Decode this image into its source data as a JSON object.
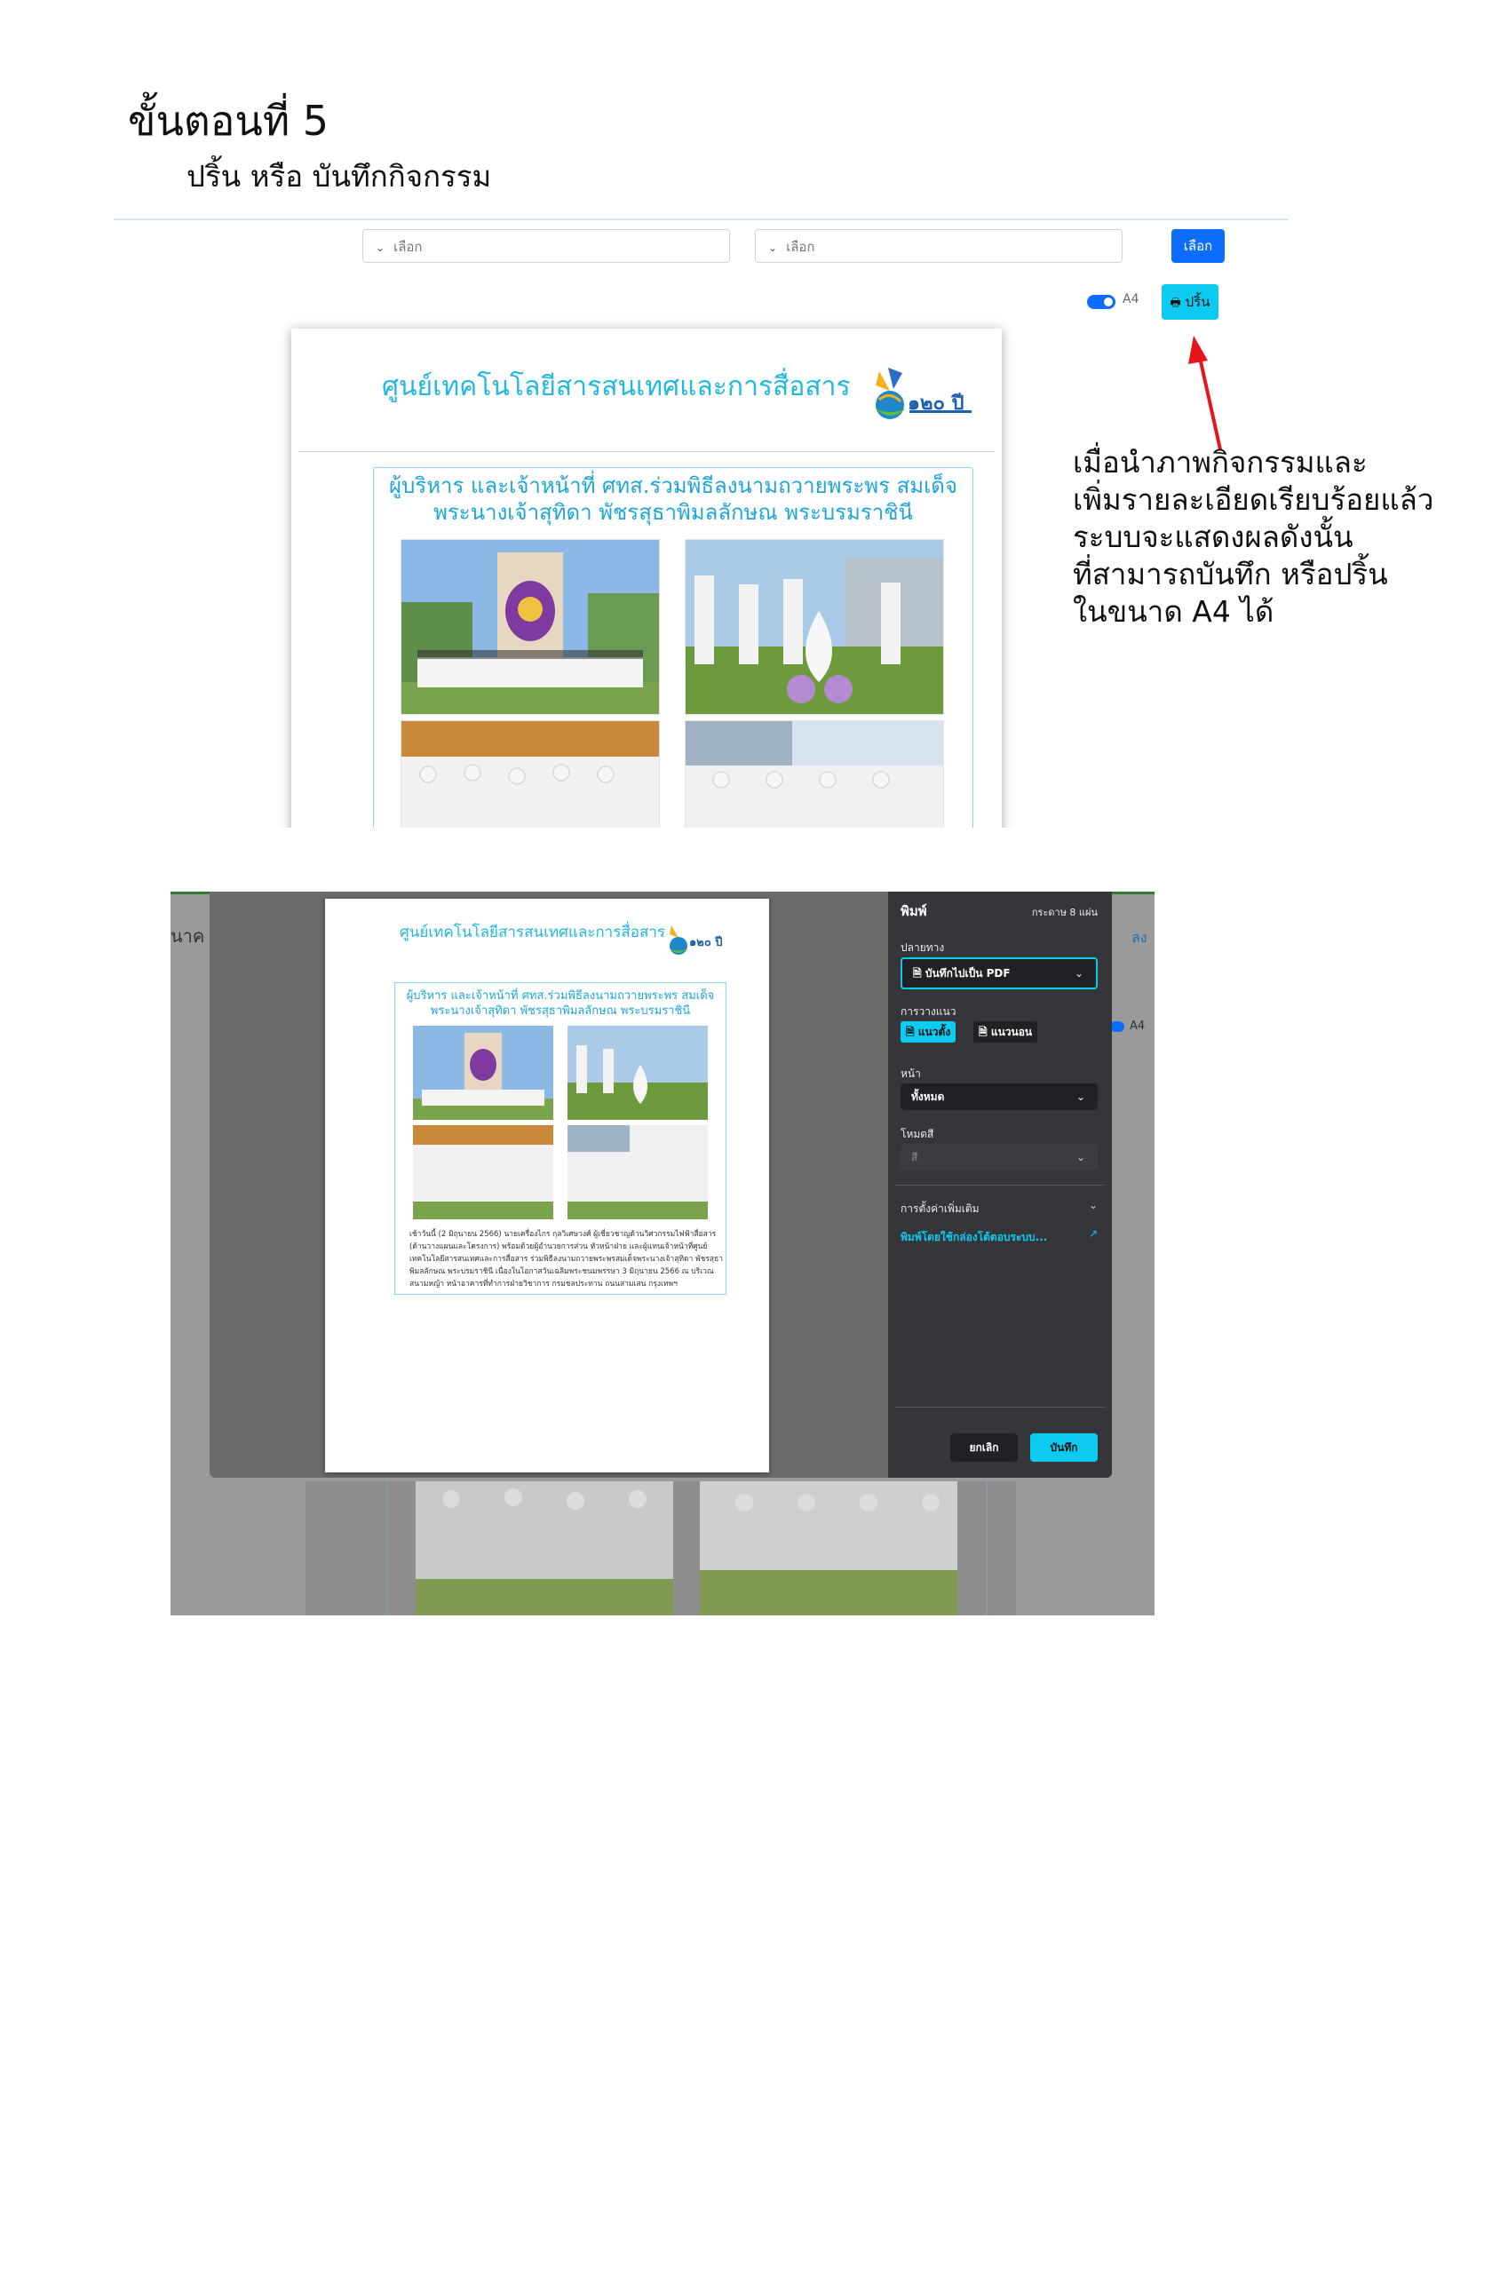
{
  "step": {
    "title": "ขั้นตอนที่ 5",
    "subtitle": "ปริ้น หรือ บันทึกกิจกรรม"
  },
  "toolbar": {
    "select1_placeholder": "เลือก",
    "select2_placeholder": "เลือก",
    "choose_button": "เลือก",
    "a4_toggle_label": "A4",
    "a4_toggle_on": true,
    "print_button": "ปริ้น"
  },
  "report": {
    "header": "ศูนย์เทคโนโลยีสารสนเทศและการสื่อสาร",
    "logo_text": "๑๒๐ ปี",
    "card_title_line1": "ผู้บริหาร และเจ้าหน้าที่ ศทส.ร่วมพิธีลงนามถวายพระพร สมเด็จ",
    "card_title_line2": "พระนางเจ้าสุทิดา พัชรสุธาพิมลลักษณ พระบรมราชินี",
    "body_text": [
      "เช้าวันนี้ (2 มิถุนายน 2566) นายเครื่องไกร กุลวิเศษวงศ์ ผู้เชี่ยวชาญด้านวิศวกรรมไฟฟ้าสื่อสาร",
      "(ด้านวางแผนและโครงการ) พร้อมด้วยผู้อำนวยการส่วน หัวหน้าฝ่าย และผู้แทนเจ้าหน้าที่ศูนย์",
      "เทคโนโลยีสารสนเทศและการสื่อสาร ร่วมพิธีลงนามถวายพระพรสมเด็จพระนางเจ้าสุทิดา พัชรสุธา",
      "พิมลลักษณ พระบรมราชินี เนื่องในโอกาสวันเฉลิมพระชนมพรรษา 3 มิถุนายน 2566 ณ บริเวณ",
      "สนามหญ้า หน้าอาคารที่ทำการฝ่ายวิชาการ กรมชลประทาน ถนนสามเสน กรุงเทพฯ"
    ]
  },
  "annotation": {
    "lines": [
      "เมื่อนำภาพกิจกรรมและ",
      "เพิ่มรายละเอียดเรียบร้อยแล้ว",
      "ระบบจะแสดงผลดังนั้น",
      "ที่สามารถบันทึก หรือปริ้น",
      "ในขนาด A4 ได้"
    ],
    "arrow_color": "#e8141b"
  },
  "print_dialog": {
    "title": "พิมพ์",
    "sheet_count": "กระดาษ 8 แผ่น",
    "destination_label": "ปลายทาง",
    "destination_value": "บันทึกไปเป็น PDF",
    "layout_label": "การวางแนว",
    "layout_portrait": "แนวตั้ง",
    "layout_landscape": "แนวนอน",
    "pages_label": "หน้า",
    "pages_value": "ทั้งหมด",
    "color_label": "โหมดสี",
    "color_value": "สี",
    "more_settings": "การตั้งค่าเพิ่มเติม",
    "system_dialog_link": "พิมพ์โดยใช้กล่องโต้ตอบระบบ...",
    "cancel_button": "ยกเลิก",
    "save_button": "บันทึก",
    "accent_color": "#0dcaf0"
  },
  "background_page": {
    "partial_left_text": "นาค",
    "partial_right_text": "ลง",
    "a4_label": "A4"
  }
}
